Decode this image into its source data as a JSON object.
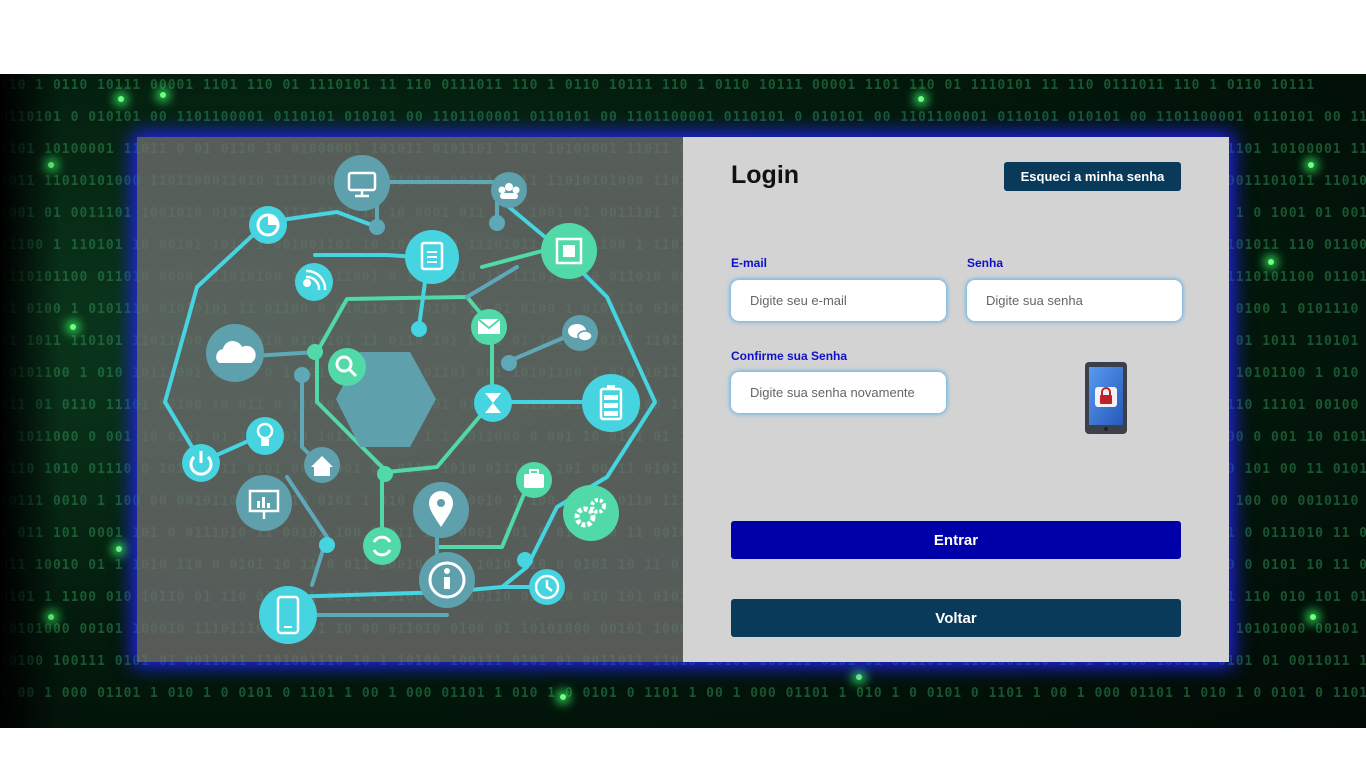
{
  "login": {
    "title": "Login",
    "forgot_password_label": "Esqueci a minha senha",
    "email_label": "E-mail",
    "email_placeholder": "Digite seu e-mail",
    "password_label": "Senha",
    "password_placeholder": "Digite sua senha",
    "confirm_label": "Confirme sua Senha",
    "confirm_placeholder": "Digite sua senha novamente",
    "enter_label": "Entrar",
    "back_label": "Voltar"
  },
  "background": {
    "binary_lines": [
      "110 1  0110    10111 00001   1101   110 01  1110101 11 110  0111011   110 1  0110  10111",
      "0110101 0  010101 00 1101100001  0110101  010101 00 1101100001  0110101 00 1101100001",
      "1101 10100001 11011 0 01   0110 10 01000001 101011 0101101   1101 10100001 11011 0 01",
      "0011 11010101000  1101100011010 1111000101 01010100 0011101011 11010101000 1101100011010",
      "1001 01 0011101 1001010 0101110 111 0101 10 10 0001 011 1 0  1001 01 0011101 1001010",
      "01100 1 110101 10 00101 1011 1 001001101 10 10110100 11101011 110 01100 1 110101 10",
      "1110101100 011010 0000 111010100 101 111001 0 111 0110 11 1110101100 011010 0000",
      "01 0100 1 0101110 01010101 11 01100 0 010110 1 00101 11 01 0100 1 0101110 010101",
      "01 1011 110101 11011000 0111 010 0110101 11 0110 101 1011 01 1011 110101 11011000",
      "10101100 1 010 1011 001 10101 0 1 101 1100101 0101101 001 10101100 1 010 1011 001",
      "011 01 0110 11101 00100 10 011 0 110101 1 10101 001 011 01 0110 11101 00100 10",
      "1 1011000 0 001 10 0101 01 10110010 1011 1000 0 1 1 1011000 0 001 10 0101 01 1011",
      "0110 1010 01110 0 101 00 11 0101 0011 001 01 0110 1010 01110 0 101 00 11 0101",
      "10111 0010 1 100 00 0010110 1111 10 0101 1 010 10111 0010 1 100 00 0010110 1111",
      "1 011 101 0001 101 0 0111010 11 00101 100 1 011 101 0001 101 0 0111010 11 00101",
      "011 10010 01 1 1010 110 0 0101 10 11 0 011 10010 01 1 1010 110 0 0101 10 11 0",
      "0101 1 1100 010 10110 01 110 010 101 0101 1 1100 010 10110 01 110 010 101 0101",
      "10101000 00101 100010 111011100111101 10 00 011010 0100 01 10101000 00101 100010",
      "10100 100111  0101 01  0011011 1101001110 10 1 10100 100111 0101 01 0011011 11010",
      "1 00 1 000 01101 1 010 1 0 0101 0 1101 1 00 1 000 01101 1 010 1 0 0101 0 1101"
    ]
  }
}
